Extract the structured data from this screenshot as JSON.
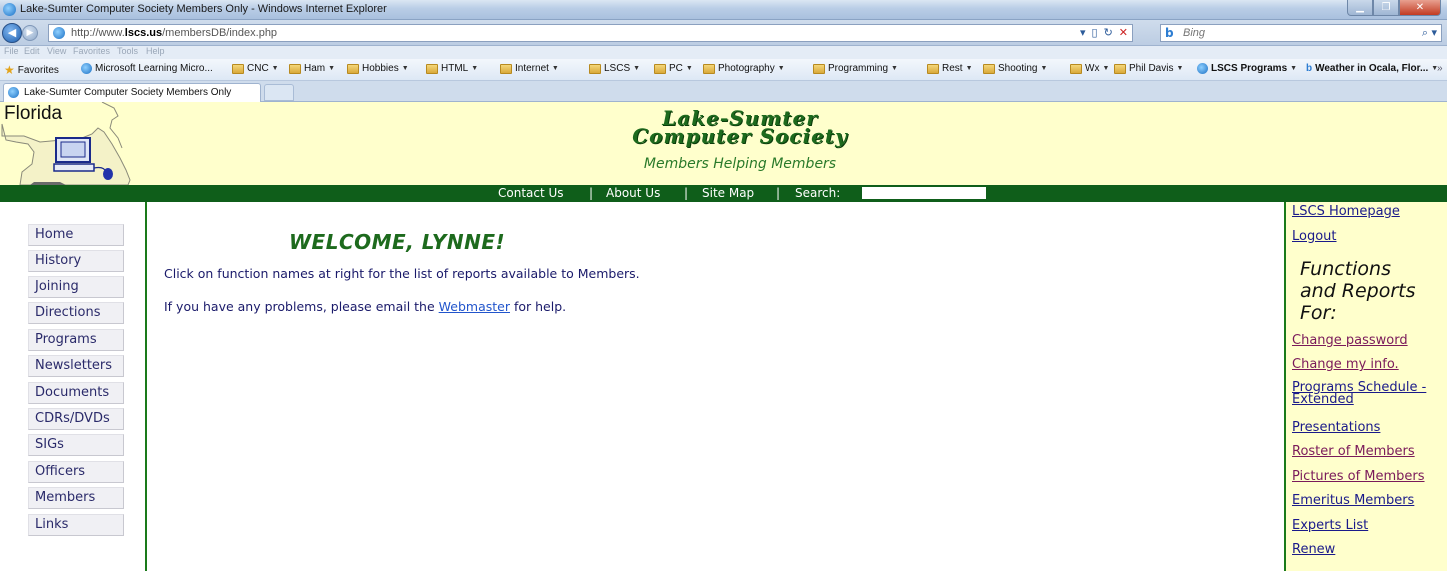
{
  "browser": {
    "window_title": "Lake-Sumter Computer Society Members Only - Windows Internet Explorer",
    "url_prefix": "http://www.",
    "url_domain": "lscs.us",
    "url_path": "/membersDB/index.php",
    "search_placeholder": "Bing",
    "menu": [
      "File",
      "Edit",
      "View",
      "Favorites",
      "Tools",
      "Help"
    ],
    "favorites_label": "Favorites",
    "favorites": [
      "Microsoft Learning Micro...",
      "CNC",
      "Ham",
      "Hobbies",
      "HTML",
      "Internet",
      "LSCS",
      "PC",
      "Photography",
      "Programming",
      "Rest",
      "Shooting",
      "Wx",
      "Phil Davis",
      "LSCS Programs",
      "Weather in Ocala, Flor..."
    ],
    "tab_title": "Lake-Sumter Computer Society Members Only"
  },
  "banner": {
    "state_label": "Florida",
    "title_line1": "Lake-Sumter",
    "title_line2": "Computer Society",
    "tagline": "Members Helping Members"
  },
  "navbar": {
    "items": [
      "Contact Us",
      "About Us",
      "Site Map",
      "Search:"
    ],
    "separator": "|"
  },
  "left_nav": [
    "Home",
    "History",
    "Joining",
    "Directions",
    "Programs",
    "Newsletters",
    "Documents",
    "CDRs/DVDs",
    "SIGs",
    "Officers",
    "Members",
    "Links"
  ],
  "main": {
    "welcome": "WELCOME, LYNNE!",
    "intro": "Click on function names at right for the list of reports available to Members.",
    "help_before": "If you have any problems, please email the ",
    "help_link": "Webmaster",
    "help_after": " for help."
  },
  "right_col": {
    "top_links": [
      "LSCS Homepage",
      "Logout"
    ],
    "heading_line1": "Functions",
    "heading_line2": "and Reports",
    "heading_line3": "For:",
    "links": [
      "Change password",
      "Change my info.",
      "Programs Schedule -",
      "Extended",
      "Presentations",
      "Roster of Members",
      "Pictures of Members",
      "Emeritus Members",
      "Experts List",
      "Renew"
    ]
  },
  "colors": {
    "banner_bg": "#ffffcc",
    "navbar_bg": "#0f5e1a",
    "accent_green": "#1d6a1d",
    "link_blue": "#1a1a8a"
  }
}
